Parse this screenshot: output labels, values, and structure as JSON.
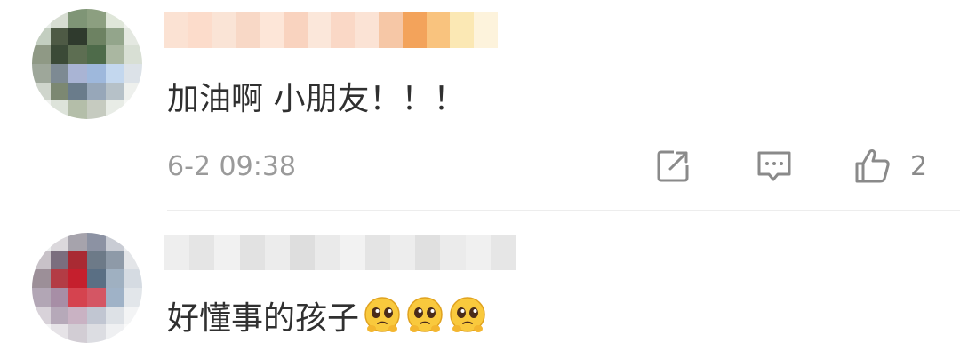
{
  "comments": [
    {
      "text": "加油啊 小朋友！！！",
      "timestamp": "6-2 09:38",
      "like_count": "2",
      "avatar_colors": [
        "#e9eee9",
        "#d7ddd2",
        "#7f9576",
        "#8c9f80",
        "#dfe6d9",
        "#f1f2ef",
        "#c3cec0",
        "#4e5a45",
        "#2f3a2d",
        "#6d8262",
        "#93a58b",
        "#e4e8e1",
        "#8f9985",
        "#3b4a37",
        "#5d6e52",
        "#4e6b4a",
        "#aab7a1",
        "#d8dfd4",
        "#9ea79a",
        "#7d8a93",
        "#a9b4d4",
        "#9eb8dc",
        "#c3d7ee",
        "#dce2e8",
        "#cfd5cc",
        "#7c8872",
        "#6a7c8b",
        "#97a7b9",
        "#b6c1c8",
        "#eef0ed",
        "#f0f2ef",
        "#dde3da",
        "#b4bea9",
        "#c6cbc0",
        "#e8ece6",
        "#f7f8f6"
      ],
      "username_colors": [
        "#fbe2d3",
        "#fcdccb",
        "#fae4d6",
        "#f8d8c6",
        "#fde6d8",
        "#f9d3bf",
        "#fbe7da",
        "#fad8c6",
        "#fbe3d5",
        "#f6c7a6",
        "#f3a35b",
        "#f9c37e",
        "#fbe8b4",
        "#fdf3dc"
      ]
    },
    {
      "text": "好懂事的孩子",
      "emoji_count": 3,
      "avatar_colors": [
        "#eef0f0",
        "#dbd8dc",
        "#a6a3ac",
        "#8c92a3",
        "#c9ccd4",
        "#eef0f2",
        "#c8c2c8",
        "#7b6e7e",
        "#a92a33",
        "#6d7a88",
        "#8e9aa8",
        "#e3e5e8",
        "#9c8f98",
        "#b33c45",
        "#c51f2d",
        "#5a6f84",
        "#9fb0c1",
        "#d5dbe2",
        "#b2a6b5",
        "#a78ea6",
        "#d5434f",
        "#d45664",
        "#9fb2c7",
        "#e2e6ea",
        "#d8d2d9",
        "#b6a9b9",
        "#c9b2c3",
        "#c1c6d2",
        "#dde1e6",
        "#f3f4f5",
        "#f4f4f5",
        "#e6e3e7",
        "#d2cdd4",
        "#dcdde2",
        "#eff0f2",
        "#fafafa"
      ],
      "username_colors": [
        "#eeeeee",
        "#e5e5e5",
        "#f1f1f1",
        "#e2e2e2",
        "#ececec",
        "#dedede",
        "#eaeaea",
        "#f2f2f2",
        "#e4e4e4",
        "#ededed",
        "#e0e0e0",
        "#ebebeb",
        "#f0f0f0",
        "#e6e6e6"
      ]
    }
  ],
  "icons": {
    "share": "share-icon",
    "reply": "comment-icon",
    "like": "thumbs-up-icon",
    "emoji": "pleading-face-emoji"
  },
  "colors": {
    "text": "#303030",
    "meta": "#9a9a9a",
    "icon": "#8a8a8a",
    "divider": "#ededed"
  }
}
